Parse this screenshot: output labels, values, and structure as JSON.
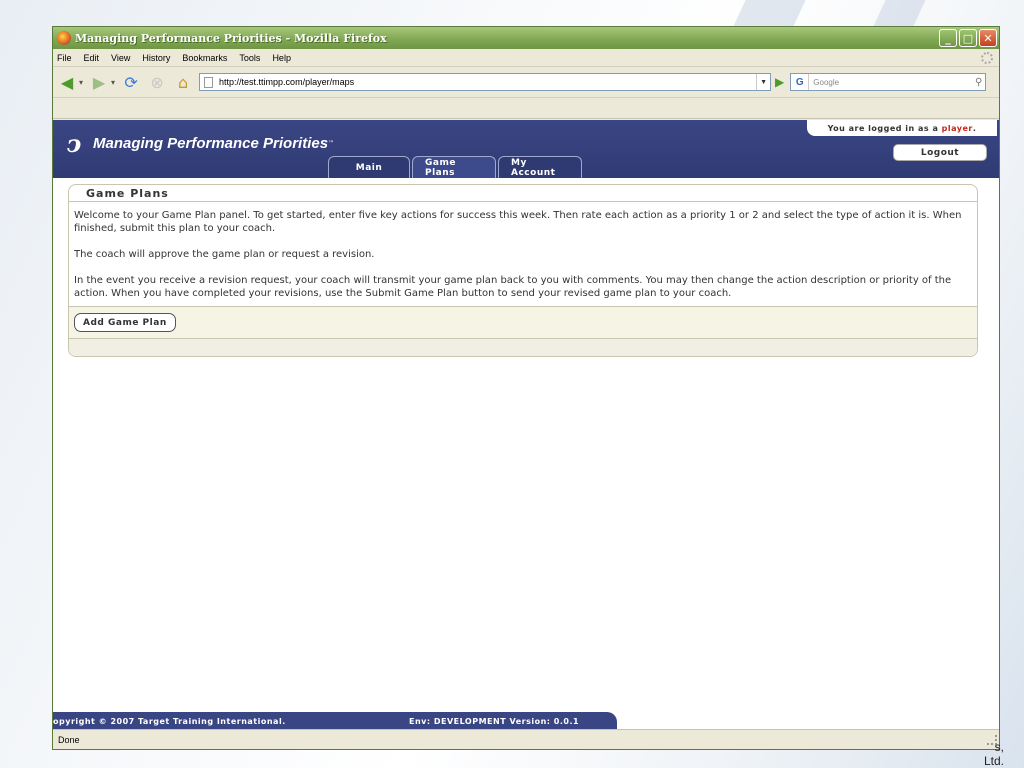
{
  "slide": {
    "corner_text_line1": "s,",
    "corner_text_line2": "Ltd."
  },
  "browser": {
    "window_title": "Managing Performance Priorities - Mozilla Firefox",
    "menu": [
      "File",
      "Edit",
      "View",
      "History",
      "Bookmarks",
      "Tools",
      "Help"
    ],
    "url": "http://test.ttimpp.com/player/maps",
    "search_placeholder": "Google",
    "status": "Done"
  },
  "app": {
    "logo_text": "Managing Performance Priorities",
    "tabs": [
      {
        "label": "Main"
      },
      {
        "label": "Game Plans"
      },
      {
        "label": "My Account"
      }
    ],
    "login_prefix": "You are logged in as a",
    "login_role": "player",
    "login_suffix": ".",
    "logout_label": "Logout"
  },
  "panel": {
    "title": "Game Plans",
    "paragraphs": [
      "Welcome to your Game Plan panel. To get started, enter five key actions for success this week. Then rate each action as a priority 1 or 2 and select the type of action it is. When finished, submit this plan to your coach.",
      "The coach will approve the game plan or request a revision.",
      "In the event you receive a revision request, your coach will transmit your game plan back to you with comments. You may then change the action description or priority of the action. When you have completed your revisions, use the Submit Game Plan button to send your revised game plan to your coach."
    ],
    "add_button": "Add Game Plan"
  },
  "footer": {
    "copyright": "opyright © 2007 Target Training International.",
    "env": "Env: DEVELOPMENT   Version: 0.0.1"
  },
  "colors": {
    "header_bg": "#3a4684",
    "role_red": "#c8261a",
    "titlebar_green": "#7fa651"
  }
}
